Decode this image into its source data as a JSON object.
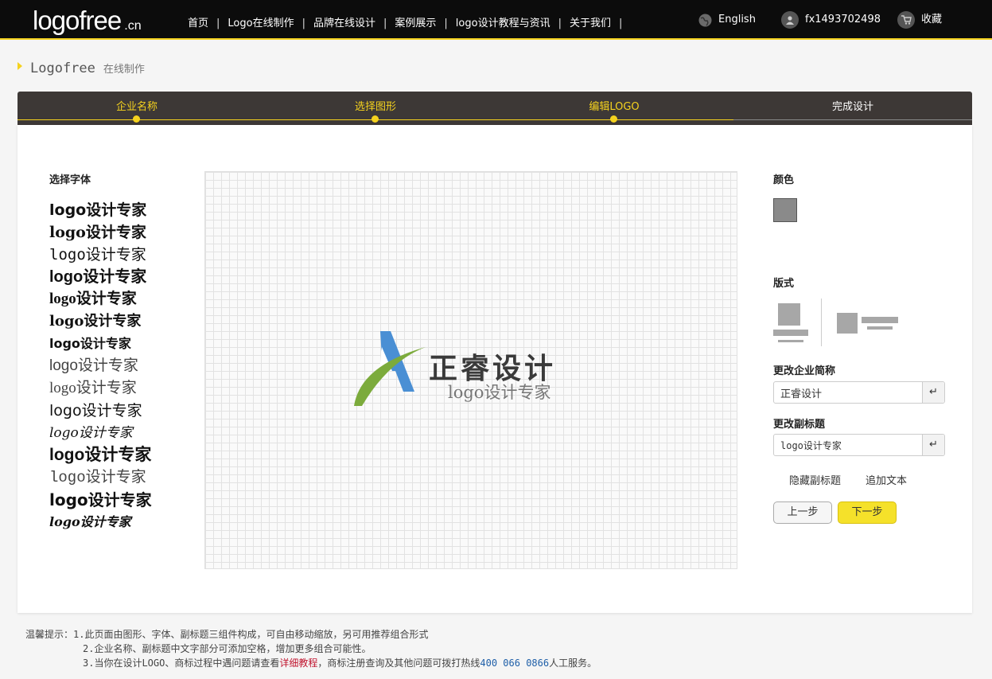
{
  "header": {
    "logo_main": "logofree",
    "logo_suffix": ".cn",
    "nav": [
      "首页",
      "Logo在线制作",
      "品牌在线设计",
      "案例展示",
      "logo设计教程与资讯",
      "关于我们"
    ],
    "separator": "|",
    "lang": "English",
    "username": "fx1493702498",
    "favorite": "收藏"
  },
  "breadcrumb": {
    "main": "Logofree",
    "sub": "在线制作"
  },
  "steps": [
    "企业名称",
    "选择图形",
    "编辑LOGO",
    "完成设计"
  ],
  "font_panel": {
    "title": "选择字体",
    "fonts": [
      "logo设计专家",
      "logo设计专家",
      "logo设计专家",
      "logo设计专家",
      "logo设计专家",
      "logo设计专家",
      "logo设计专家",
      "logo设计专家",
      "logo设计专家",
      "logo设计专家",
      "logo设计专家",
      "logo设计专家",
      "logo设计专家",
      "logo设计专家",
      "logo设计专家"
    ]
  },
  "canvas": {
    "title": "正睿设计",
    "subtitle": "logo设计专家",
    "mark_colors": [
      "#4a8fd4",
      "#7cab3c"
    ]
  },
  "right_panel": {
    "color_title": "颜色",
    "color_value": "#8a8a8a",
    "layout_title": "版式",
    "company_label": "更改企业简称",
    "company_value": "正睿设计",
    "subtitle_label": "更改副标题",
    "subtitle_value": "logo设计专家",
    "enter_icon": "↵",
    "hide_subtitle": "隐藏副标题",
    "add_text": "追加文本",
    "prev": "上一步",
    "next": "下一步"
  },
  "tips": {
    "label": "温馨提示：",
    "line1": "1.此页面由图形、字体、副标题三组件构成，可自由移动缩放，另可用推荐组合形式",
    "line2": "2.企业名称、副标题中文字部分可添加空格，增加更多组合可能性。",
    "line3_a": "3.当你在设计LOGO、商标过程中遇问题请查看",
    "line3_link": "详细教程",
    "line3_b": "，商标注册查询及其他问题可拨打热线",
    "line3_phone": "400 066 0866",
    "line3_c": "人工服务。"
  }
}
